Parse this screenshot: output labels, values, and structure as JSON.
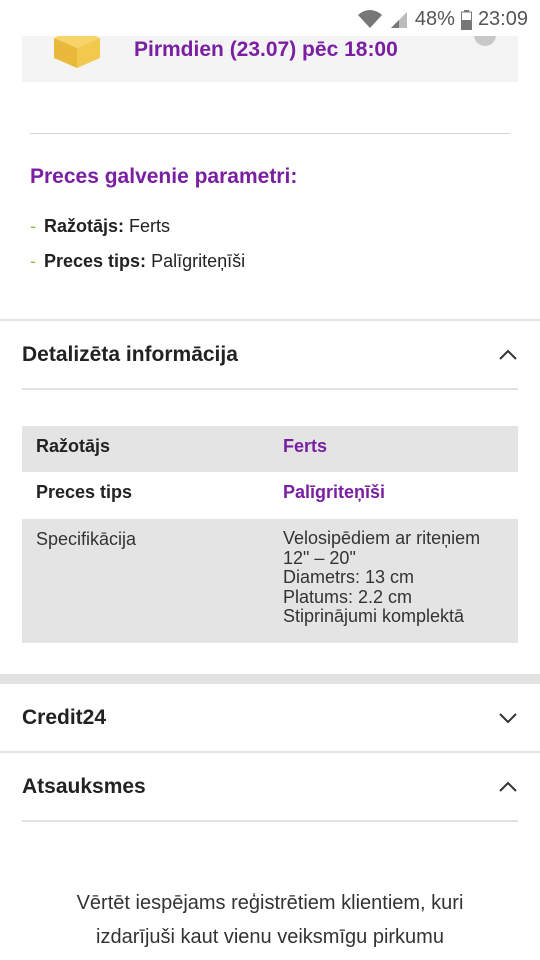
{
  "status_bar": {
    "battery": "48%",
    "time": "23:09"
  },
  "delivery": {
    "text": "Pirmdien (23.07) pēc 18:00"
  },
  "main_params": {
    "title": "Preces galvenie parametri:",
    "items": [
      {
        "key": "Ražotājs:",
        "value": "Ferts"
      },
      {
        "key": "Preces tips:",
        "value": "Palīgriteņīši"
      }
    ]
  },
  "details": {
    "title": "Detalizēta informācija",
    "rows": [
      {
        "key": "Ražotājs",
        "value": "Ferts"
      },
      {
        "key": "Preces tips",
        "value": "Palīgriteņīši"
      },
      {
        "key": "Specifikācija",
        "lines": [
          "Velosipēdiem ar riteņiem",
          "12\" – 20\"",
          "Diametrs: 13 cm",
          "Platums: 2.2 cm",
          "Stiprinājumi komplektā"
        ]
      }
    ]
  },
  "credit": {
    "title": "Credit24"
  },
  "reviews": {
    "title": "Atsauksmes",
    "note_lines": [
      "Vērtēt iespējams reģistrētiem klientiem, kuri",
      "izdarījuši kaut vienu veiksmīgu pirkumu"
    ]
  },
  "colors": {
    "accent": "#7a1fa2",
    "bullet": "#8bc34a",
    "table_stripe": "#e4e4e4"
  }
}
